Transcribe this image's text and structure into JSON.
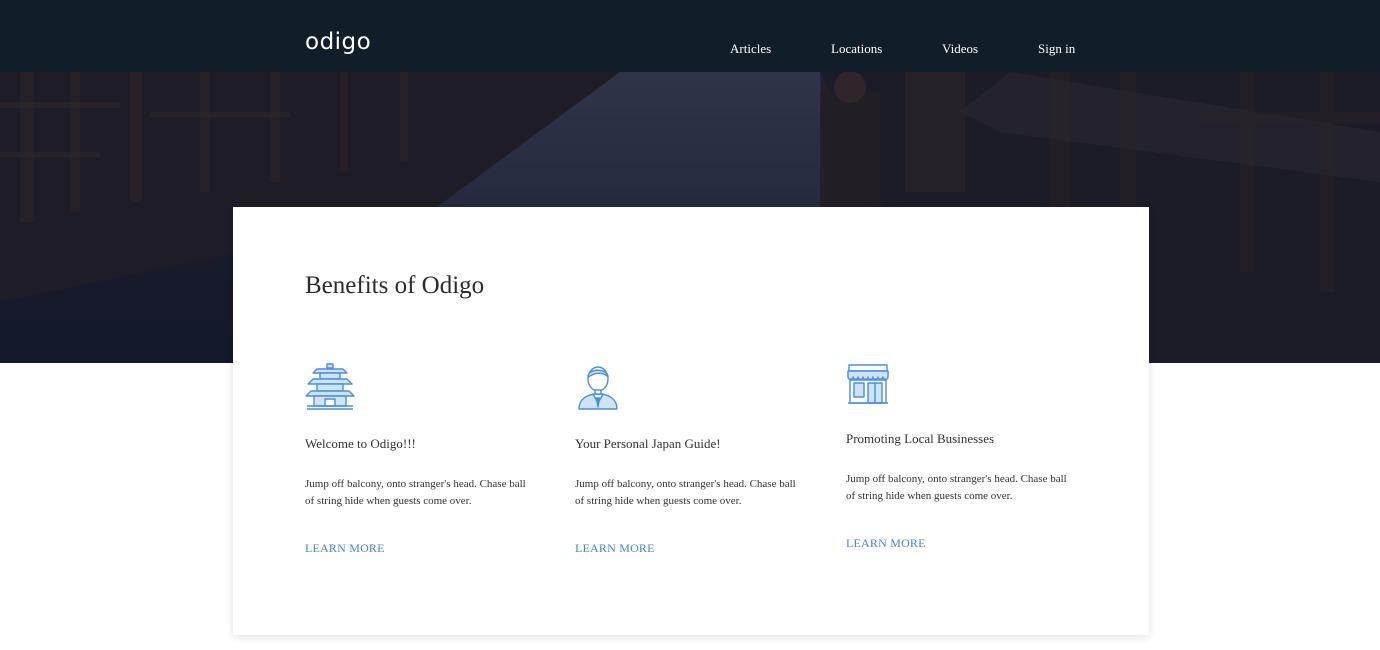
{
  "header": {
    "logo": "odigo",
    "nav": [
      "Articles",
      "Locations",
      "Videos",
      "Sign in"
    ]
  },
  "main": {
    "title": "Benefits of Odigo",
    "features": [
      {
        "icon": "pagoda-icon",
        "title": "Welcome to Odigo!!!",
        "description": "Jump off balcony, onto stranger's head. Chase ball of string hide when guests come over.",
        "link": "LEARN MORE"
      },
      {
        "icon": "guide-person-icon",
        "title": "Your Personal Japan Guide!",
        "description": "Jump off balcony, onto stranger's head. Chase ball of string hide when guests come over.",
        "link": "LEARN MORE"
      },
      {
        "icon": "storefront-icon",
        "title": "Promoting Local Businesses",
        "description": "Jump off balcony, onto stranger's head. Chase ball of string hide when guests come over.",
        "link": "LEARN MORE"
      }
    ]
  },
  "colors": {
    "header_bg": "#111d29",
    "link": "#4a86c8",
    "icon_stroke": "#4a90d9",
    "icon_fill": "#cfe3f7"
  }
}
